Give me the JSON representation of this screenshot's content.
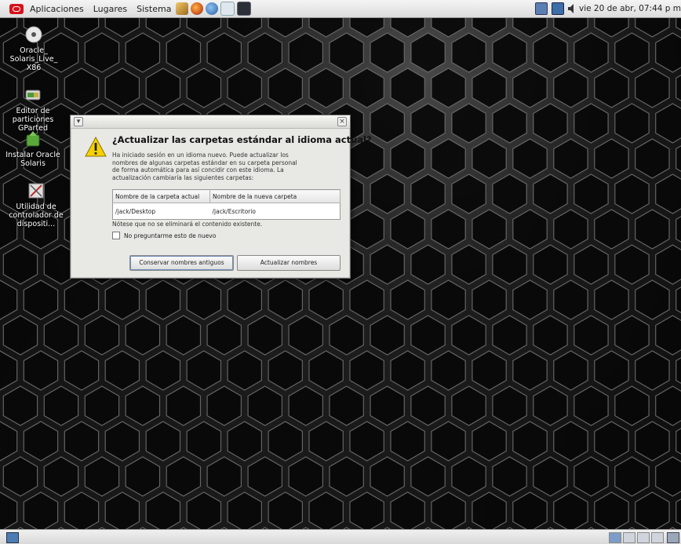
{
  "top_panel": {
    "menus": [
      "Aplicaciones",
      "Lugares",
      "Sistema"
    ],
    "clock": "vie 20 de abr, 07:44 p m"
  },
  "desktop_icons": [
    {
      "label": "Oracle_ Solaris_Live_ X86",
      "icon": "disc-icon"
    },
    {
      "label": "Editor de particiones GParted",
      "icon": "gparted-icon"
    },
    {
      "label": "Instalar Oracle Solaris",
      "icon": "install-icon"
    },
    {
      "label": "Utilidad de controlador de dispositi...",
      "icon": "device-driver-icon"
    }
  ],
  "dialog": {
    "heading": "¿Actualizar las carpetas estándar al idioma actual?",
    "body": "Ha iniciado sesión en un idioma nuevo. Puede actualizar los nombres de algunas carpetas estándar en su carpeta personal de forma automática para así concidir con este idioma. La actualización cambiaría las siguientes carpetas:",
    "table": {
      "headers": [
        "Nombre de la carpeta actual",
        "Nombre de la nueva carpeta"
      ],
      "rows": [
        [
          "/jack/Desktop",
          "/jack/Escritorio"
        ]
      ]
    },
    "notice": "Nótese que no se eliminará el contenido existente.",
    "checkbox_label": "No preguntarme esto de nuevo",
    "keep_button": "Conservar nombres antiguos",
    "update_button": "Actualizar nombres",
    "warning_color": "#f5d100"
  },
  "colors": {
    "oracle_red": "#d5121b",
    "panel_bg": "#e6e6e6"
  }
}
